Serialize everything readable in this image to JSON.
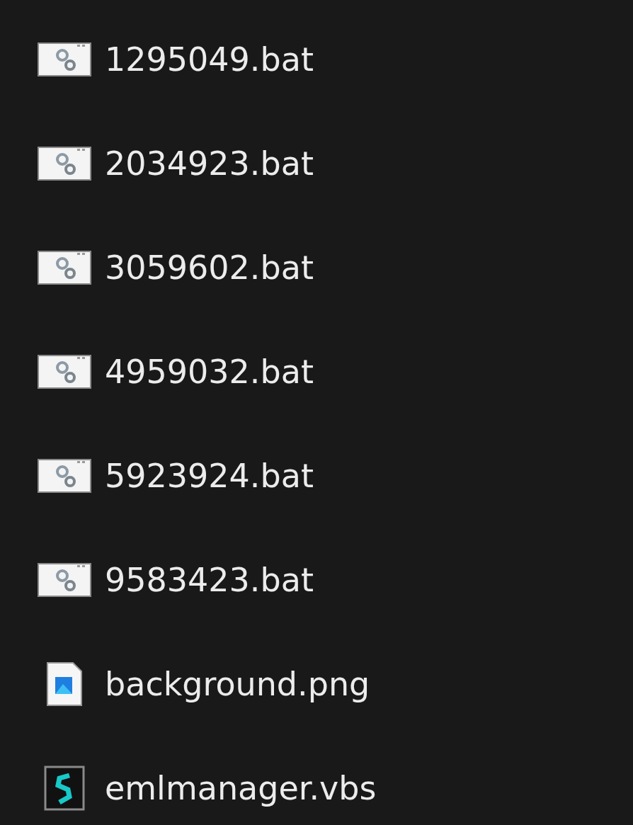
{
  "files": [
    {
      "name": "1295049.bat",
      "kind": "batch"
    },
    {
      "name": "2034923.bat",
      "kind": "batch"
    },
    {
      "name": "3059602.bat",
      "kind": "batch"
    },
    {
      "name": "4959032.bat",
      "kind": "batch"
    },
    {
      "name": "5923924.bat",
      "kind": "batch"
    },
    {
      "name": "9583423.bat",
      "kind": "batch"
    },
    {
      "name": "background.png",
      "kind": "image"
    },
    {
      "name": "emlmanager.vbs",
      "kind": "script"
    }
  ]
}
